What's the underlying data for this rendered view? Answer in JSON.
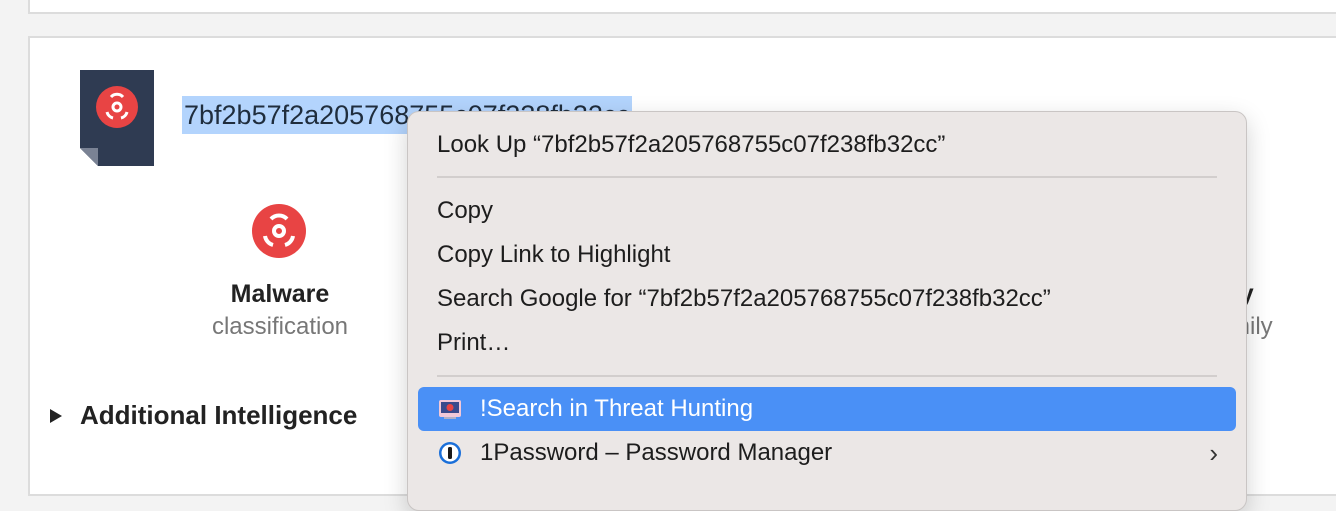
{
  "file": {
    "hash_display": "7bf2b57f2a205768755c07f238fb32cc"
  },
  "stats": [
    {
      "title": "Malware",
      "subtitle": "classification"
    },
    {
      "title": "ry",
      "subtitle": "mily"
    }
  ],
  "additional_label": "Additional Intelligence",
  "context_menu": {
    "look_up": "Look Up “7bf2b57f2a205768755c07f238fb32cc”",
    "copy": "Copy",
    "copy_link": "Copy Link to Highlight",
    "search_google": "Search Google for “7bf2b57f2a205768755c07f238fb32cc”",
    "print": "Print…",
    "threat_hunting": "!Search in Threat Hunting",
    "onepassword": "1Password – Password Manager"
  },
  "colors": {
    "danger": "#e84444",
    "file_icon": "#2f3b52",
    "selection": "#b3d4fd",
    "menu_highlight": "#4a90f6"
  },
  "icons": [
    "biohazard-icon",
    "threat-hunting-icon",
    "onepassword-icon",
    "chevron-right-icon"
  ]
}
